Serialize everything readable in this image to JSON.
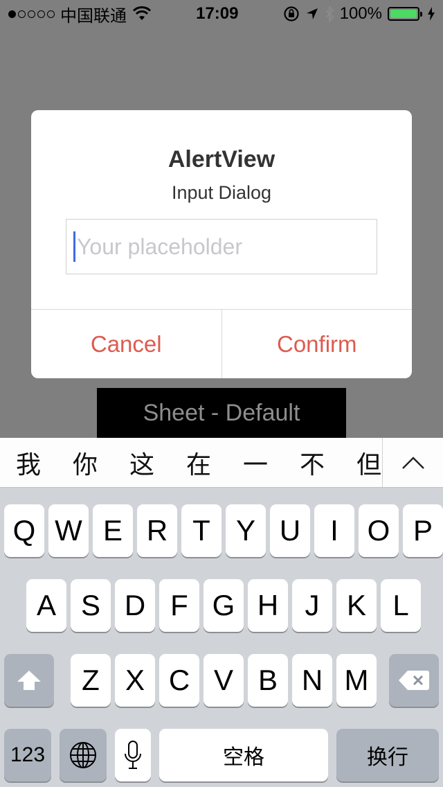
{
  "status_bar": {
    "carrier": "中国联通",
    "time": "17:09",
    "battery": "100%",
    "battery_level": 1.0,
    "signal_bars_filled": 1,
    "signal_bars_total": 5
  },
  "background": {
    "sheet_button_label": "Sheet - Default"
  },
  "alert": {
    "title": "AlertView",
    "message": "Input Dialog",
    "input_placeholder": "Your placeholder",
    "input_value": "",
    "cancel_label": "Cancel",
    "confirm_label": "Confirm",
    "accent_color": "#dd5b4f"
  },
  "candidates": [
    "我",
    "你",
    "这",
    "在",
    "一",
    "不",
    "但"
  ],
  "keyboard": {
    "row1": [
      "Q",
      "W",
      "E",
      "R",
      "T",
      "Y",
      "U",
      "I",
      "O",
      "P"
    ],
    "row2": [
      "A",
      "S",
      "D",
      "F",
      "G",
      "H",
      "J",
      "K",
      "L"
    ],
    "row3": [
      "Z",
      "X",
      "C",
      "V",
      "B",
      "N",
      "M"
    ],
    "numbers_label": "123",
    "space_label": "空格",
    "return_label": "换行",
    "icons": {
      "shift": "shift-arrow-icon",
      "delete": "backspace-icon",
      "globe": "globe-icon",
      "mic": "microphone-icon",
      "expand": "chevron-up-icon"
    }
  }
}
